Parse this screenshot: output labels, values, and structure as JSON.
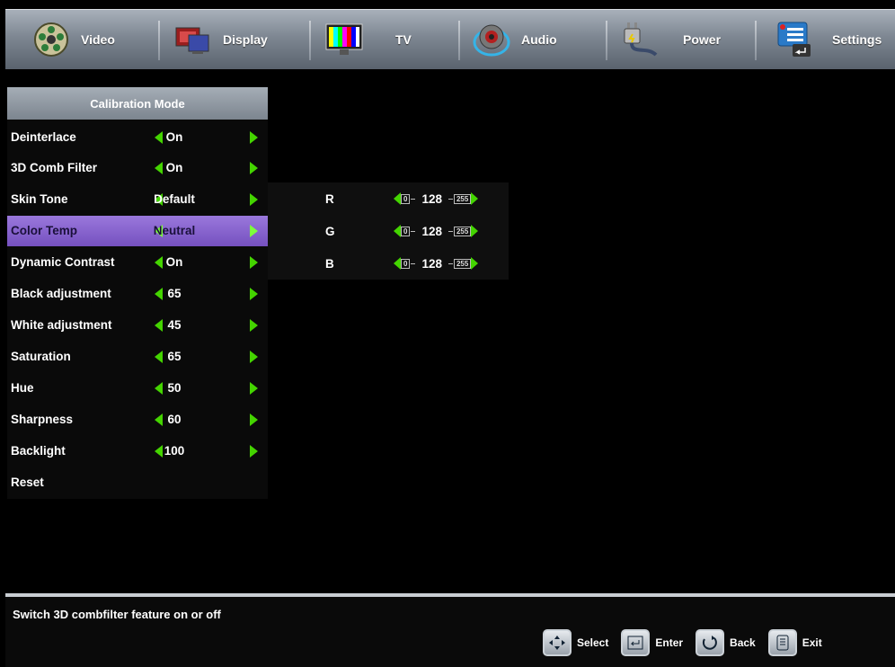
{
  "tabs": [
    {
      "label": "Video",
      "icon": "film-reel-icon"
    },
    {
      "label": "Display",
      "icon": "display-monitors-icon"
    },
    {
      "label": "TV",
      "icon": "tv-test-pattern-icon"
    },
    {
      "label": "Audio",
      "icon": "speaker-icon"
    },
    {
      "label": "Power",
      "icon": "power-plug-icon"
    },
    {
      "label": "Settings",
      "icon": "settings-menu-icon"
    }
  ],
  "menu": {
    "header": "Calibration Mode",
    "items": [
      {
        "name": "Deinterlace",
        "value": "On"
      },
      {
        "name": "3D Comb Filter",
        "value": "On"
      },
      {
        "name": "Skin Tone",
        "value": "Default"
      },
      {
        "name": "Color Temp",
        "value": "Neutral"
      },
      {
        "name": "Dynamic Contrast",
        "value": "On"
      },
      {
        "name": "Black adjustment",
        "value": "65"
      },
      {
        "name": "White adjustment",
        "value": "45"
      },
      {
        "name": "Saturation",
        "value": "65"
      },
      {
        "name": "Hue",
        "value": "50"
      },
      {
        "name": "Sharpness",
        "value": "60"
      },
      {
        "name": "Backlight",
        "value": "100"
      },
      {
        "name": "Reset",
        "value": ""
      }
    ],
    "selected_index": 3
  },
  "color_temp": {
    "channels": [
      {
        "label": "R",
        "value": "128",
        "min": "0",
        "max": "255"
      },
      {
        "label": "G",
        "value": "128",
        "min": "0",
        "max": "255"
      },
      {
        "label": "B",
        "value": "128",
        "min": "0",
        "max": "255"
      }
    ]
  },
  "help_text": "Switch 3D combfilter  feature  on or off",
  "hints": [
    {
      "label": "Select",
      "icon": "dpad-icon"
    },
    {
      "label": "Enter",
      "icon": "enter-key-icon"
    },
    {
      "label": "Back",
      "icon": "back-arrow-icon"
    },
    {
      "label": "Exit",
      "icon": "exit-menu-icon"
    }
  ],
  "colors": {
    "selected_row": "#8a66d0",
    "arrow": "#44d400"
  }
}
